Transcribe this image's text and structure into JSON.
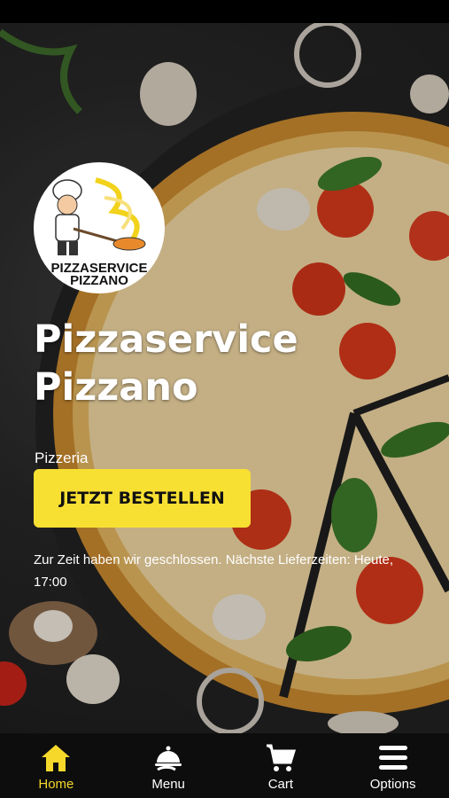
{
  "logo": {
    "line1": "PIZZASERVICE",
    "line2": "PIZZANO"
  },
  "hero": {
    "title": "Pizzaservice Pizzano",
    "subtitle": "Pizzeria",
    "order_button": "JETZT BESTELLEN",
    "notice": "Zur Zeit haben wir geschlossen. Nächste Lieferzeiten: Heute, 17:00"
  },
  "nav": {
    "home": "Home",
    "menu": "Menu",
    "cart": "Cart",
    "options": "Options"
  },
  "colors": {
    "accent": "#f8e033",
    "active_nav": "#f6d82b",
    "navbar_bg": "#0d0d0d"
  },
  "icons": {
    "home": "home-icon",
    "menu": "serving-dish-icon",
    "cart": "cart-icon",
    "options": "hamburger-icon"
  }
}
